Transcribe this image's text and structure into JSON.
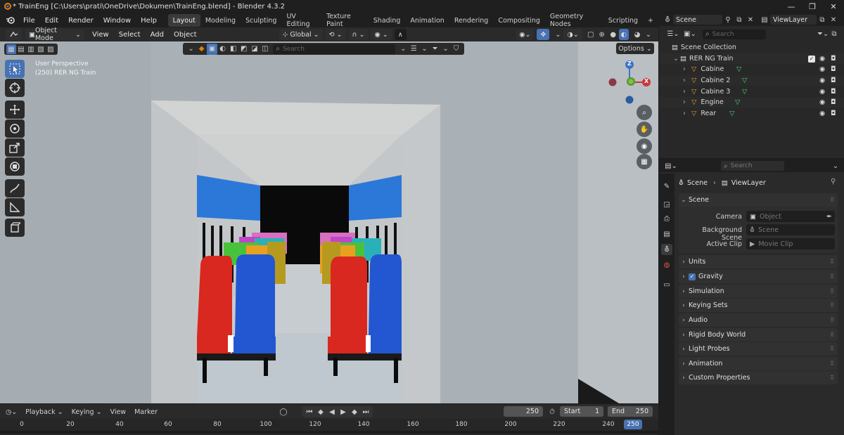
{
  "window": {
    "title": "* TrainEng [C:\\Users\\prati\\OneDrive\\Dokumen\\TrainEng.blend] - Blender 4.3.2"
  },
  "menubar": {
    "items": [
      "File",
      "Edit",
      "Render",
      "Window",
      "Help"
    ]
  },
  "workspaces": [
    "Layout",
    "Modeling",
    "Sculpting",
    "UV Editing",
    "Texture Paint",
    "Shading",
    "Animation",
    "Rendering",
    "Compositing",
    "Geometry Nodes",
    "Scripting"
  ],
  "active_workspace": "Layout",
  "top_right": {
    "scene": "Scene",
    "view_layer": "ViewLayer"
  },
  "viewport_header": {
    "mode": "Object Mode",
    "menus": [
      "View",
      "Select",
      "Add",
      "Object"
    ],
    "orientation": "Global",
    "options": "Options",
    "search_placeholder": "Search"
  },
  "viewport": {
    "overlay_line1": "User Perspective",
    "overlay_line2": "(250) RER NG Train",
    "axes": {
      "z": "Z",
      "x": "X"
    },
    "colors": {
      "selected_tool": "#4772b3",
      "axis_x": "#c8383c",
      "axis_y": "#5a9a2a",
      "axis_z": "#3c74c8"
    }
  },
  "outliner": {
    "search_placeholder": "Search",
    "root": "Scene Collection",
    "collection": "RER NG Train",
    "objects": [
      "Cabine",
      "Cabine 2",
      "Cabine 3",
      "Engine",
      "Rear"
    ]
  },
  "properties": {
    "search_placeholder": "Search",
    "breadcrumb": [
      "Scene",
      "ViewLayer"
    ],
    "scene_panel": {
      "title": "Scene",
      "camera_label": "Camera",
      "camera_value": "Object",
      "bg_label": "Background Scene",
      "bg_value": "Scene",
      "clip_label": "Active Clip",
      "clip_value": "Movie Clip"
    },
    "panels": [
      "Units",
      "Gravity",
      "Simulation",
      "Keying Sets",
      "Audio",
      "Rigid Body World",
      "Light Probes",
      "Animation",
      "Custom Properties"
    ],
    "gravity_checked": true
  },
  "timeline": {
    "menus": [
      "Playback",
      "Keying",
      "View",
      "Marker"
    ],
    "current_frame": "250",
    "start_label": "Start",
    "start": "1",
    "end_label": "End",
    "end": "250",
    "ticks": [
      "0",
      "20",
      "40",
      "60",
      "80",
      "100",
      "120",
      "140",
      "160",
      "180",
      "200",
      "220",
      "240"
    ],
    "playhead": "250"
  }
}
